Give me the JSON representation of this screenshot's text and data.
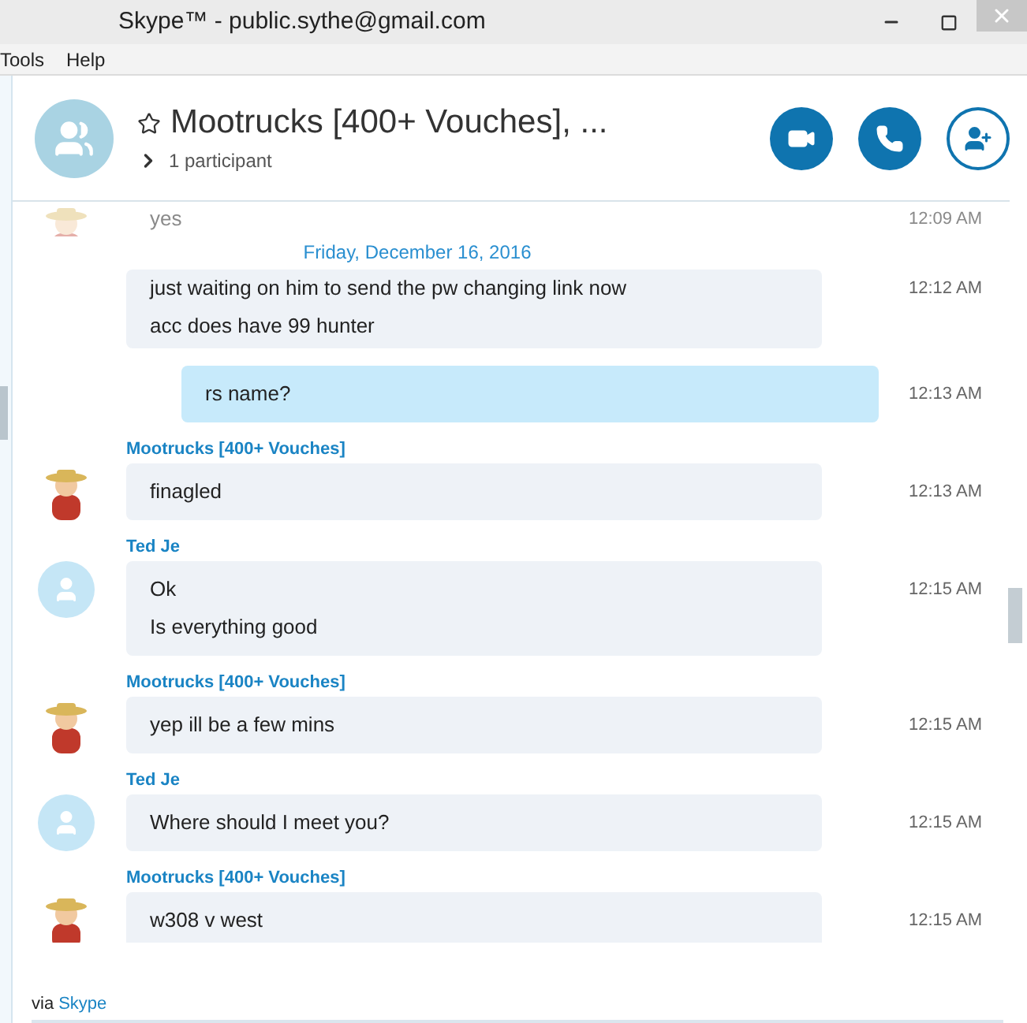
{
  "window": {
    "title": "Skype™ - public.sythe@gmail.com"
  },
  "menu": [
    "Tools",
    "Help"
  ],
  "conversation": {
    "title": "Mootrucks [400+ Vouches], ...",
    "participants": "1 participant",
    "favorite": false
  },
  "faded_message": {
    "text": "yes",
    "time": "12:09 AM",
    "avatar": {
      "kind": "picture"
    }
  },
  "date_divider": "Friday, December 16, 2016",
  "messages": [
    {
      "kind": "incoming",
      "lines": [
        "just waiting on him to send the pw changing link now",
        "acc does have 99 hunter"
      ],
      "time": "12:12 AM"
    },
    {
      "kind": "outgoing",
      "lines": [
        "rs name?"
      ],
      "time": "12:13 AM"
    },
    {
      "kind": "incoming",
      "sender": "Mootrucks [400+ Vouches]",
      "avatar": {
        "kind": "picture"
      },
      "lines": [
        "finagled"
      ],
      "time": "12:13 AM"
    },
    {
      "kind": "incoming",
      "sender": "Ted Je",
      "avatar": {
        "kind": "default"
      },
      "lines": [
        "Ok",
        "Is everything good"
      ],
      "time": "12:15 AM"
    },
    {
      "kind": "incoming",
      "sender": "Mootrucks [400+ Vouches]",
      "avatar": {
        "kind": "picture"
      },
      "lines": [
        "yep ill be a few mins"
      ],
      "time": "12:15 AM"
    },
    {
      "kind": "incoming",
      "sender": "Ted Je",
      "avatar": {
        "kind": "default"
      },
      "lines": [
        "Where should I meet you?"
      ],
      "time": "12:15 AM"
    },
    {
      "kind": "incoming",
      "sender": "Mootrucks [400+ Vouches]",
      "avatar": {
        "kind": "picture"
      },
      "lines": [
        "w308 v west"
      ],
      "time": "12:15 AM"
    }
  ],
  "footer": {
    "prefix": "via",
    "link": "Skype"
  }
}
